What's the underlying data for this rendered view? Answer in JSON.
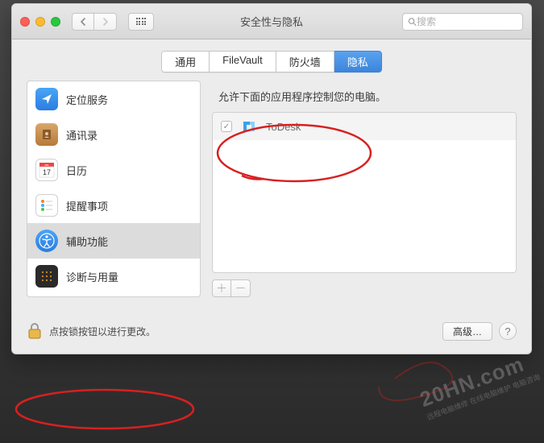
{
  "window": {
    "title": "安全性与隐私"
  },
  "search": {
    "placeholder": "搜索"
  },
  "tabs": [
    {
      "label": "通用"
    },
    {
      "label": "FileVault"
    },
    {
      "label": "防火墙"
    },
    {
      "label": "隐私"
    }
  ],
  "active_tab_index": 3,
  "sidebar": {
    "items": [
      {
        "label": "定位服务"
      },
      {
        "label": "通讯录"
      },
      {
        "label": "日历"
      },
      {
        "label": "提醒事项"
      },
      {
        "label": "辅助功能"
      },
      {
        "label": "诊断与用量"
      }
    ],
    "selected_index": 4
  },
  "detail": {
    "description": "允许下面的应用程序控制您的电脑。",
    "apps": [
      {
        "name": "ToDesk",
        "checked": true
      }
    ]
  },
  "footer": {
    "lock_text": "点按锁按钮以进行更改。",
    "advanced_label": "高级…",
    "help_label": "?"
  },
  "watermark": {
    "text": "20HN.com",
    "subtitle": "远程电脑维修 在线电脑维护 电脑咨询"
  }
}
